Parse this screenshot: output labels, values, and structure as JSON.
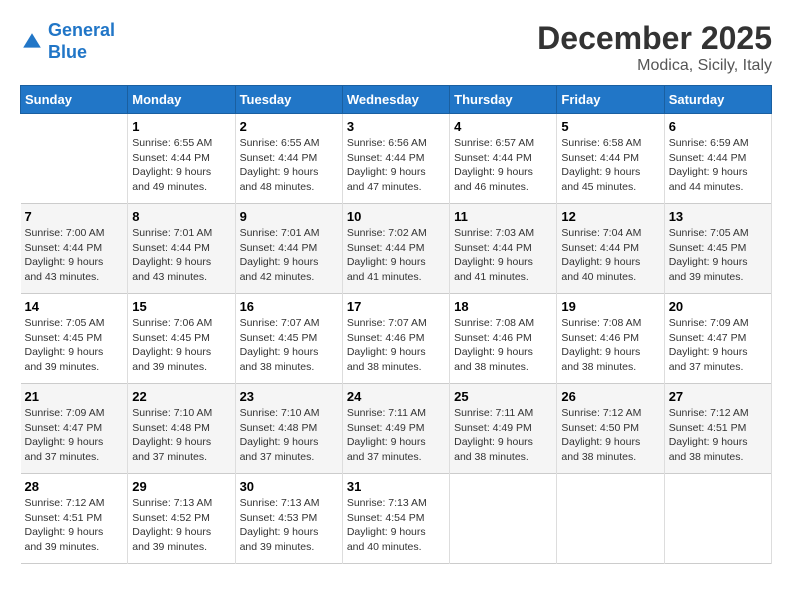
{
  "header": {
    "logo_line1": "General",
    "logo_line2": "Blue",
    "month": "December 2025",
    "location": "Modica, Sicily, Italy"
  },
  "weekdays": [
    "Sunday",
    "Monday",
    "Tuesday",
    "Wednesday",
    "Thursday",
    "Friday",
    "Saturday"
  ],
  "weeks": [
    [
      {
        "day": "",
        "info": ""
      },
      {
        "day": "1",
        "info": "Sunrise: 6:55 AM\nSunset: 4:44 PM\nDaylight: 9 hours\nand 49 minutes."
      },
      {
        "day": "2",
        "info": "Sunrise: 6:55 AM\nSunset: 4:44 PM\nDaylight: 9 hours\nand 48 minutes."
      },
      {
        "day": "3",
        "info": "Sunrise: 6:56 AM\nSunset: 4:44 PM\nDaylight: 9 hours\nand 47 minutes."
      },
      {
        "day": "4",
        "info": "Sunrise: 6:57 AM\nSunset: 4:44 PM\nDaylight: 9 hours\nand 46 minutes."
      },
      {
        "day": "5",
        "info": "Sunrise: 6:58 AM\nSunset: 4:44 PM\nDaylight: 9 hours\nand 45 minutes."
      },
      {
        "day": "6",
        "info": "Sunrise: 6:59 AM\nSunset: 4:44 PM\nDaylight: 9 hours\nand 44 minutes."
      }
    ],
    [
      {
        "day": "7",
        "info": "Sunrise: 7:00 AM\nSunset: 4:44 PM\nDaylight: 9 hours\nand 43 minutes."
      },
      {
        "day": "8",
        "info": "Sunrise: 7:01 AM\nSunset: 4:44 PM\nDaylight: 9 hours\nand 43 minutes."
      },
      {
        "day": "9",
        "info": "Sunrise: 7:01 AM\nSunset: 4:44 PM\nDaylight: 9 hours\nand 42 minutes."
      },
      {
        "day": "10",
        "info": "Sunrise: 7:02 AM\nSunset: 4:44 PM\nDaylight: 9 hours\nand 41 minutes."
      },
      {
        "day": "11",
        "info": "Sunrise: 7:03 AM\nSunset: 4:44 PM\nDaylight: 9 hours\nand 41 minutes."
      },
      {
        "day": "12",
        "info": "Sunrise: 7:04 AM\nSunset: 4:44 PM\nDaylight: 9 hours\nand 40 minutes."
      },
      {
        "day": "13",
        "info": "Sunrise: 7:05 AM\nSunset: 4:45 PM\nDaylight: 9 hours\nand 39 minutes."
      }
    ],
    [
      {
        "day": "14",
        "info": "Sunrise: 7:05 AM\nSunset: 4:45 PM\nDaylight: 9 hours\nand 39 minutes."
      },
      {
        "day": "15",
        "info": "Sunrise: 7:06 AM\nSunset: 4:45 PM\nDaylight: 9 hours\nand 39 minutes."
      },
      {
        "day": "16",
        "info": "Sunrise: 7:07 AM\nSunset: 4:45 PM\nDaylight: 9 hours\nand 38 minutes."
      },
      {
        "day": "17",
        "info": "Sunrise: 7:07 AM\nSunset: 4:46 PM\nDaylight: 9 hours\nand 38 minutes."
      },
      {
        "day": "18",
        "info": "Sunrise: 7:08 AM\nSunset: 4:46 PM\nDaylight: 9 hours\nand 38 minutes."
      },
      {
        "day": "19",
        "info": "Sunrise: 7:08 AM\nSunset: 4:46 PM\nDaylight: 9 hours\nand 38 minutes."
      },
      {
        "day": "20",
        "info": "Sunrise: 7:09 AM\nSunset: 4:47 PM\nDaylight: 9 hours\nand 37 minutes."
      }
    ],
    [
      {
        "day": "21",
        "info": "Sunrise: 7:09 AM\nSunset: 4:47 PM\nDaylight: 9 hours\nand 37 minutes."
      },
      {
        "day": "22",
        "info": "Sunrise: 7:10 AM\nSunset: 4:48 PM\nDaylight: 9 hours\nand 37 minutes."
      },
      {
        "day": "23",
        "info": "Sunrise: 7:10 AM\nSunset: 4:48 PM\nDaylight: 9 hours\nand 37 minutes."
      },
      {
        "day": "24",
        "info": "Sunrise: 7:11 AM\nSunset: 4:49 PM\nDaylight: 9 hours\nand 37 minutes."
      },
      {
        "day": "25",
        "info": "Sunrise: 7:11 AM\nSunset: 4:49 PM\nDaylight: 9 hours\nand 38 minutes."
      },
      {
        "day": "26",
        "info": "Sunrise: 7:12 AM\nSunset: 4:50 PM\nDaylight: 9 hours\nand 38 minutes."
      },
      {
        "day": "27",
        "info": "Sunrise: 7:12 AM\nSunset: 4:51 PM\nDaylight: 9 hours\nand 38 minutes."
      }
    ],
    [
      {
        "day": "28",
        "info": "Sunrise: 7:12 AM\nSunset: 4:51 PM\nDaylight: 9 hours\nand 39 minutes."
      },
      {
        "day": "29",
        "info": "Sunrise: 7:13 AM\nSunset: 4:52 PM\nDaylight: 9 hours\nand 39 minutes."
      },
      {
        "day": "30",
        "info": "Sunrise: 7:13 AM\nSunset: 4:53 PM\nDaylight: 9 hours\nand 39 minutes."
      },
      {
        "day": "31",
        "info": "Sunrise: 7:13 AM\nSunset: 4:54 PM\nDaylight: 9 hours\nand 40 minutes."
      },
      {
        "day": "",
        "info": ""
      },
      {
        "day": "",
        "info": ""
      },
      {
        "day": "",
        "info": ""
      }
    ]
  ]
}
